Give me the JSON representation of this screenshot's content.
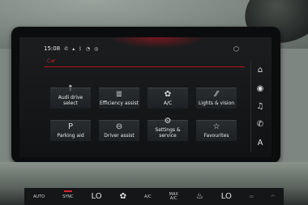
{
  "status_bar": {
    "time": "15:08",
    "icons": [
      "phone-icon",
      "signal-icon",
      "bluetooth-icon",
      "network-icon",
      "location-icon"
    ]
  },
  "search": {
    "text": "Car"
  },
  "tiles": [
    {
      "id": "audi-drive-select",
      "label": "Audi drive\nselect",
      "icon": "drive-select-icon",
      "glyph": "⇡"
    },
    {
      "id": "efficiency-assist",
      "label": "Efficiency assist",
      "icon": "efficiency-icon",
      "glyph": "≣"
    },
    {
      "id": "ac",
      "label": "A/C",
      "icon": "fan-icon",
      "glyph": "✿"
    },
    {
      "id": "lights-vision",
      "label": "Lights & vision",
      "icon": "headlight-icon",
      "glyph": "⁄⁄"
    },
    {
      "id": "parking-aid",
      "label": "Parking aid",
      "icon": "parking-icon",
      "glyph": "P"
    },
    {
      "id": "driver-assist",
      "label": "Driver assist",
      "icon": "steering-wheel-icon",
      "glyph": "⊖"
    },
    {
      "id": "settings-service",
      "label": "Settings &\nservice",
      "icon": "settings-wrench-icon",
      "glyph": "⚙"
    },
    {
      "id": "favourites",
      "label": "Favourites",
      "icon": "star-icon",
      "glyph": "☆"
    }
  ],
  "side_rail": [
    {
      "icon": "home-icon",
      "glyph": "⌂"
    },
    {
      "icon": "radio-icon",
      "glyph": "◉"
    },
    {
      "icon": "music-icon",
      "glyph": "♫"
    },
    {
      "icon": "phone-icon",
      "glyph": "✆"
    },
    {
      "icon": "navigation-icon",
      "glyph": "A"
    }
  ],
  "climate_panel": {
    "auto": "AUTO",
    "sync": "SYNC",
    "left_temp": "LO",
    "ac": "A/C",
    "max_ac": "MAX\nA/C",
    "right_temp": "LO"
  },
  "colors": {
    "accent_red": "#c8262f",
    "screen_bg": "#141618",
    "tile_bg": "#25282b"
  }
}
